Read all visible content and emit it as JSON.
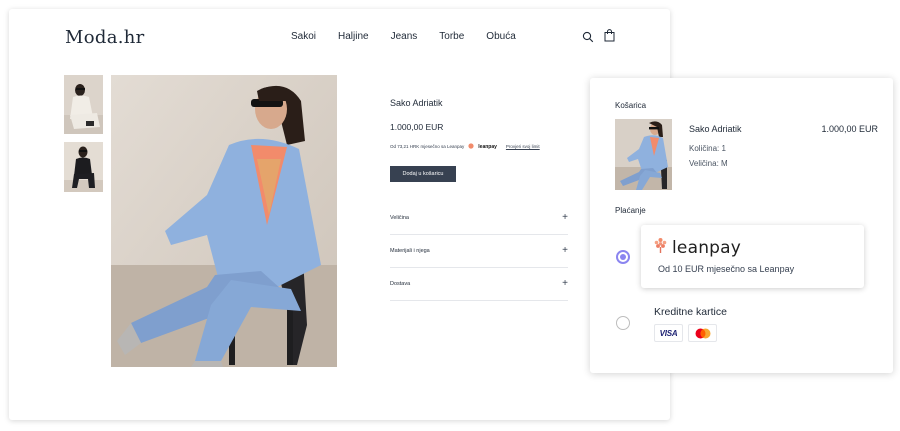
{
  "shop": {
    "logo": "Moda.hr",
    "nav": [
      "Sakoi",
      "Haljine",
      "Jeans",
      "Torbe",
      "Obuća"
    ],
    "icons": {
      "search": "search-icon",
      "bag": "shopping-bag-icon"
    }
  },
  "product": {
    "title": "Sako Adriatik",
    "price": "1.000,00 EUR",
    "installment_text": "Od 73,21 HRK mjesečno sa Leanpay",
    "leanpay_brand": "leanpay",
    "limit_link": "Provjeri svoj limit",
    "add_to_cart": "Dodaj u košaricu",
    "accordion": [
      "Veličina",
      "Materijali i njega",
      "Dostava"
    ]
  },
  "cart": {
    "heading": "Košarica",
    "item": {
      "name": "Sako Adriatik",
      "price": "1.000,00 EUR",
      "quantity": "Količina: 1",
      "size": "Veličina: M"
    },
    "payment_heading": "Plaćanje",
    "options": [
      {
        "brand": "leanpay",
        "description": "Od 10 EUR mjesečno sa Leanpay",
        "selected": true
      },
      {
        "title": "Kreditne kartice",
        "cards": [
          "VISA",
          "Mastercard"
        ],
        "selected": false
      }
    ]
  },
  "colors": {
    "primary_button": "#374151",
    "radio_selected": "#8b85f0",
    "jacket_blue": "#8fb1de",
    "leanpay_accent": "#f28b6b"
  }
}
